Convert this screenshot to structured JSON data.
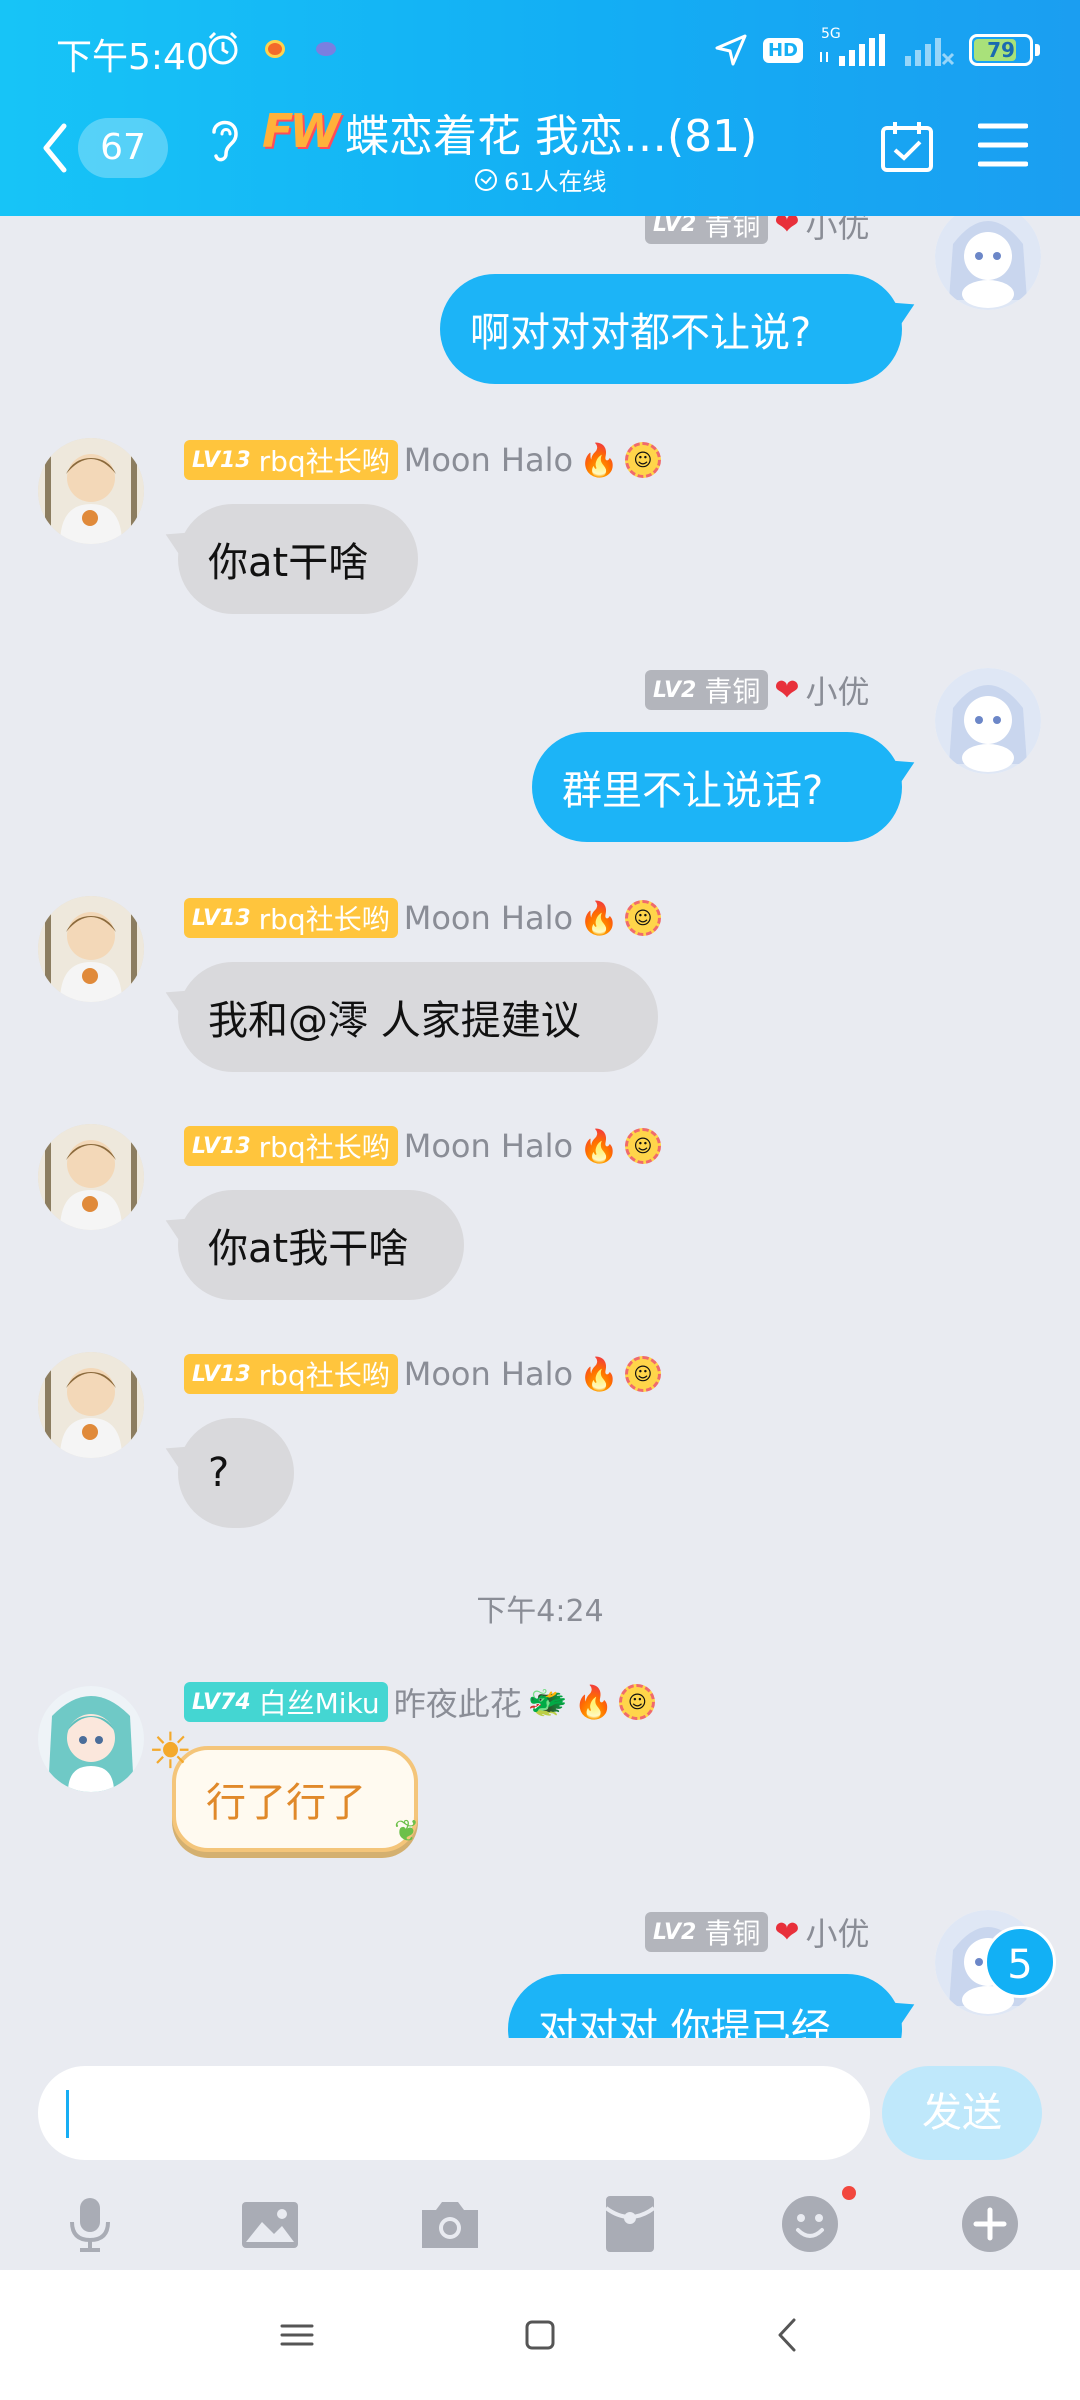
{
  "status_bar": {
    "time": "下午5:40",
    "hd": "HD",
    "network": "5G",
    "battery": "79",
    "battery_level": 0.79
  },
  "header": {
    "unread_count": "67",
    "group_badge": "FW",
    "title": "蝶恋着花 我恋…(81)",
    "online": "61人在线"
  },
  "messages": [
    {
      "side": "right",
      "level": "LV2",
      "rank": "青铜",
      "nick": "小优",
      "text": "啊对对对都不让说?"
    },
    {
      "side": "left",
      "level": "LV13",
      "rank": "rbq社长哟",
      "nick": "Moon Halo",
      "text": "你at干啥"
    },
    {
      "side": "right",
      "level": "LV2",
      "rank": "青铜",
      "nick": "小优",
      "text": "群里不让说话?"
    },
    {
      "side": "left",
      "level": "LV13",
      "rank": "rbq社长哟",
      "nick": "Moon Halo",
      "text": "我和@澪 人家提建议"
    },
    {
      "side": "left",
      "level": "LV13",
      "rank": "rbq社长哟",
      "nick": "Moon Halo",
      "text": "你at我干啥"
    },
    {
      "side": "left",
      "level": "LV13",
      "rank": "rbq社长哟",
      "nick": "Moon Halo",
      "text": "?"
    },
    {
      "timestamp": "下午4:24"
    },
    {
      "side": "left",
      "level": "LV74",
      "rank": "白丝Miku",
      "nick": "昨夜此花",
      "text": "行了行了"
    },
    {
      "side": "right",
      "level": "LV2",
      "rank": "青铜",
      "nick": "小优",
      "text": "对对对 你提已经"
    }
  ],
  "new_message_count": "5",
  "composer": {
    "input_value": "",
    "send_label": "发送"
  },
  "icons": {
    "back": "chevron-left-icon",
    "ear": "ear-icon",
    "calendar": "calendar-check-icon",
    "menu": "menu-icon",
    "toolbar": [
      "microphone-icon",
      "image-icon",
      "camera-icon",
      "red-packet-icon",
      "emoji-icon",
      "plus-icon"
    ],
    "nav": [
      "recents-icon",
      "home-icon",
      "back-icon"
    ]
  },
  "colors": {
    "header": "#17b6f6",
    "my_bubble": "#1cb4f7",
    "other_bubble": "#d9d9dc",
    "background": "#e9ebf1"
  }
}
